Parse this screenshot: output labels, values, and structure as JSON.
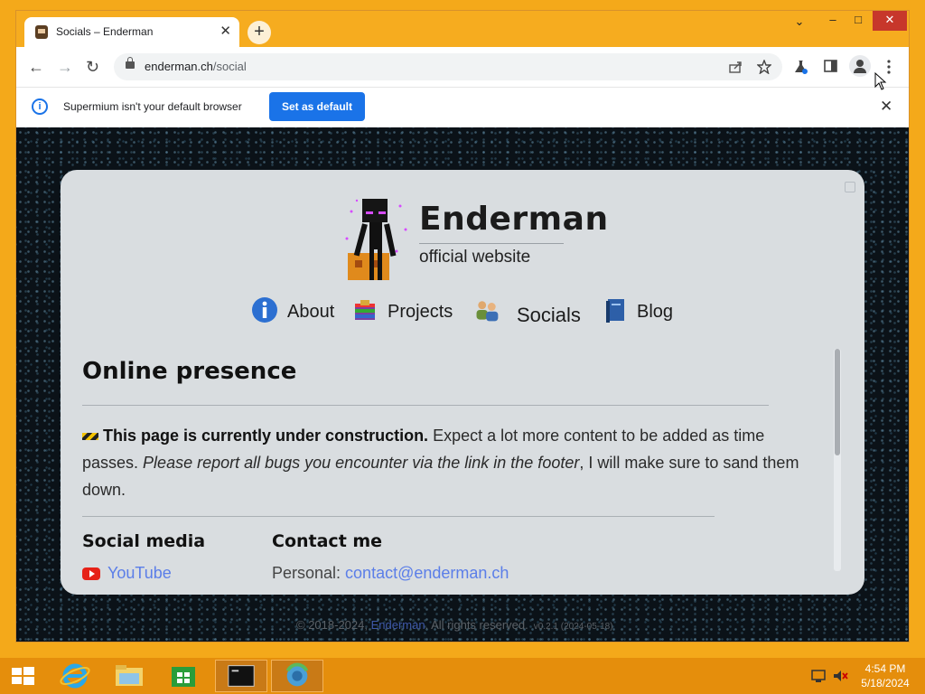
{
  "browser": {
    "tab": {
      "title": "Socials – Enderman",
      "close": "✕"
    },
    "new_tab": "+",
    "window_controls": {
      "menu": "⌄",
      "minimize": "–",
      "maximize": "□",
      "close": "✕"
    },
    "nav": {
      "back": "←",
      "forward": "→",
      "reload": "↻"
    },
    "address": {
      "domain": "enderman.ch",
      "path": "/social"
    },
    "icons": [
      "share-icon",
      "bookmark-star-icon",
      "labs-flask-icon",
      "side-panel-icon",
      "profile-icon",
      "menu-dots-icon"
    ],
    "infobar": {
      "message": "Supermium isn't your default browser",
      "button": "Set as default",
      "close": "✕",
      "info": "i"
    }
  },
  "site": {
    "brand": "Enderman",
    "subtitle": "official website",
    "nav": [
      {
        "label": "About",
        "icon": "info-icon"
      },
      {
        "label": "Projects",
        "icon": "projects-box-icon"
      },
      {
        "label": "Socials",
        "icon": "people-icon"
      },
      {
        "label": "Blog",
        "icon": "book-icon"
      }
    ],
    "heading": "Online presence",
    "notice": {
      "bold": "This page is currently under construction.",
      "text": " Expect a lot more content to be added as time passes. ",
      "italic": "Please report all bugs you encounter via the link in the footer",
      "end": ", I will make sure to sand them down."
    },
    "social_heading": "Social media",
    "contact_heading": "Contact me",
    "social_first": "YouTube",
    "contact_label": "Personal: ",
    "contact_email": "contact@enderman.ch",
    "footer": {
      "text": "© 2018-2024, ",
      "name": "Enderman",
      "rights": ". All rights reserved.",
      "version": "v0.2.1 (2024-05-18)"
    }
  },
  "taskbar": {
    "items": [
      "start-button",
      "internet-explorer-icon",
      "file-explorer-icon",
      "store-icon",
      "command-prompt-icon",
      "supermium-icon"
    ],
    "time": "4:54 PM",
    "date": "5/18/2024"
  },
  "colors": {
    "accent": "#1a73e8",
    "tabbar": "#f6ac1f",
    "taskbar": "#e58e0c",
    "card": "#d9dde0",
    "link": "#5b7ee8"
  }
}
